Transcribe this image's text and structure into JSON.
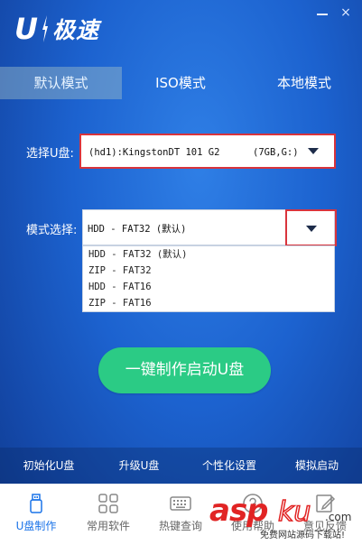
{
  "app": {
    "logo_letter": "U",
    "logo_text": "极速"
  },
  "window": {
    "minimize": "—",
    "close": "×"
  },
  "tabs": [
    {
      "label": "默认模式",
      "active": true
    },
    {
      "label": "ISO模式",
      "active": false
    },
    {
      "label": "本地模式",
      "active": false
    }
  ],
  "form": {
    "udisk_label": "选择U盘:",
    "udisk_value": "(hd1):KingstonDT 101 G2",
    "udisk_capacity": "(7GB,G:)",
    "mode_label": "模式选择:",
    "mode_value": "HDD - FAT32 (默认)",
    "mode_options": [
      "HDD - FAT32 (默认)",
      "ZIP - FAT32",
      "HDD - FAT16",
      "ZIP - FAT16"
    ]
  },
  "main_button": "一键制作启动U盘",
  "functions": [
    "初始化U盘",
    "升级U盘",
    "个性化设置",
    "模拟启动"
  ],
  "bottom_nav": [
    {
      "label": "U盘制作",
      "icon": "usb-drive-icon",
      "active": true
    },
    {
      "label": "常用软件",
      "icon": "grid-icon",
      "active": false
    },
    {
      "label": "热键查询",
      "icon": "keyboard-icon",
      "active": false
    },
    {
      "label": "使用帮助",
      "icon": "help-icon",
      "active": false
    },
    {
      "label": "意见反馈",
      "icon": "edit-icon",
      "active": false
    }
  ],
  "watermark": {
    "asp": "asp",
    "ku": "ku",
    "com": ".com",
    "sub": "免费网站源码下载站!"
  },
  "colors": {
    "accent_green": "#2bcb85",
    "highlight_red": "#d9343c",
    "active_blue": "#1a73e8"
  }
}
